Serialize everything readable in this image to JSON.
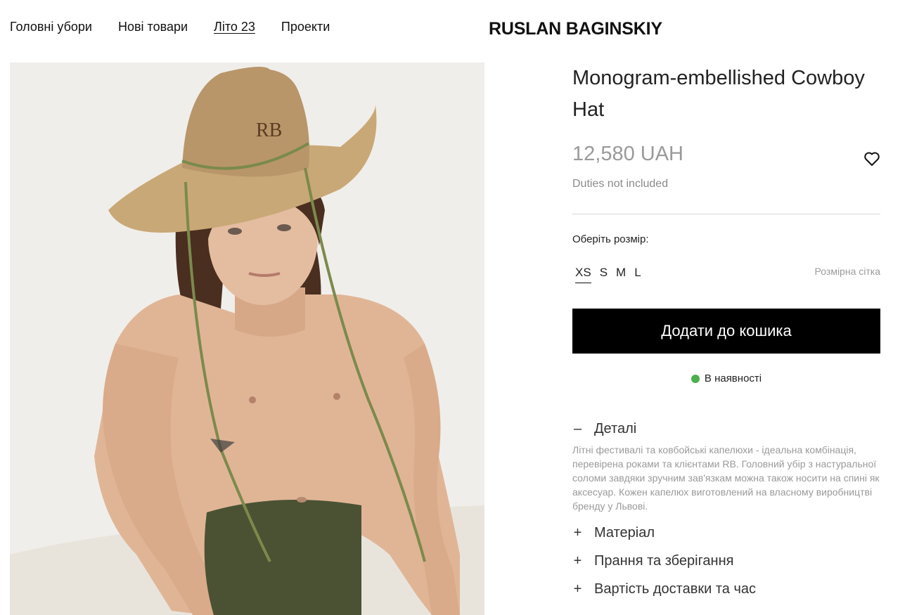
{
  "nav": {
    "items": [
      {
        "label": "Головні убори",
        "active": false
      },
      {
        "label": "Нові товари",
        "active": false
      },
      {
        "label": "Літо 23",
        "active": true
      },
      {
        "label": "Проекти",
        "active": false
      }
    ]
  },
  "brand": {
    "logo_text": "RUSLAN BAGINSKIY"
  },
  "product": {
    "image_icon": "product-photo",
    "title": "Monogram-embellished Cowboy Hat",
    "price": "12,580 UAH",
    "duties": "Duties not included",
    "wishlist_icon": "heart-icon",
    "size_label": "Оберіть розмір:",
    "sizes": [
      "XS",
      "S",
      "M",
      "L"
    ],
    "selected_size": "XS",
    "size_guide": "Розмірна сітка",
    "add_to_cart": "Додати до кошика",
    "stock_status": "В наявності",
    "stock_color": "#4caf50"
  },
  "accordion": {
    "details": {
      "label": "Деталі",
      "icon": "minus-icon",
      "text": "Літні фестивалі та ковбойські капелюхи - ідеальна комбінація, перевірена роками та клієнтами RB. Головний убір з настуральної соломи завдяки зручним зав'язкам можна також носити на спині як аксесуар. Кожен капелюх виготовлений на власному виробництві бренду у Львові."
    },
    "material": {
      "label": "Матеріал",
      "icon": "plus-icon"
    },
    "care": {
      "label": "Прання та зберігання",
      "icon": "plus-icon"
    },
    "delivery": {
      "label": "Вартість доставки та час",
      "icon": "plus-icon"
    }
  }
}
